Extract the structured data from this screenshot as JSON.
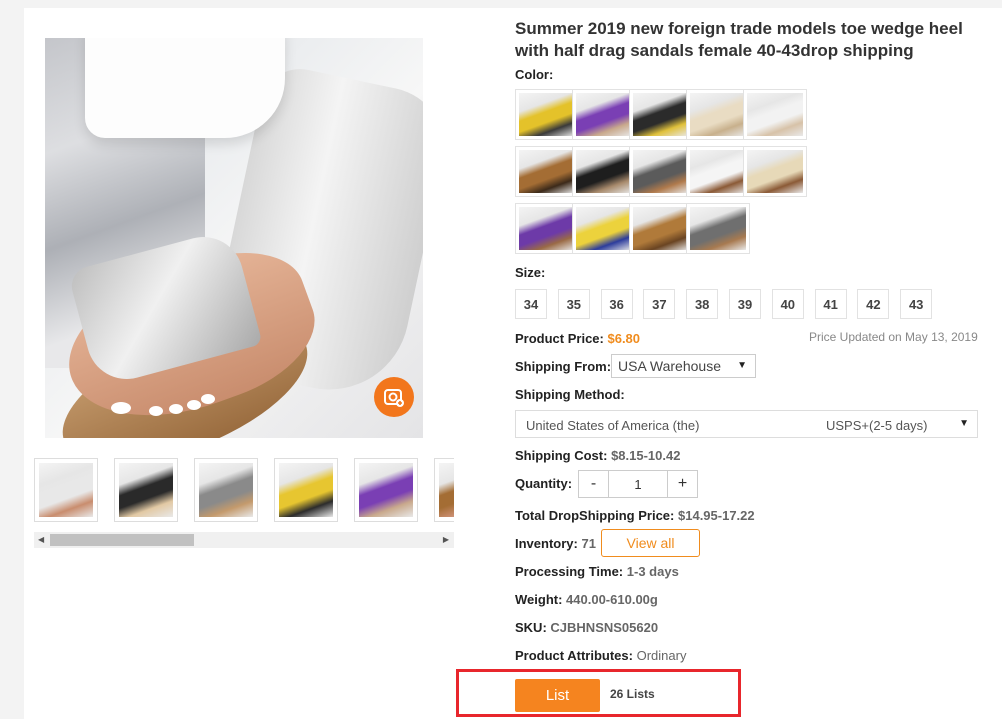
{
  "product": {
    "title": "Summer 2019 new foreign trade models toe wedge heel with half drag sandals female 40-43drop shipping"
  },
  "color": {
    "label": "Color:",
    "swatches": [
      {
        "name": "yellow-black",
        "colors": [
          "#e4c22a",
          "#3a3a3a"
        ]
      },
      {
        "name": "purple",
        "colors": [
          "#7a3fb4",
          "#c9a98c"
        ]
      },
      {
        "name": "black-yellow",
        "colors": [
          "#2b2b2b",
          "#e0c13b"
        ]
      },
      {
        "name": "beige",
        "colors": [
          "#e9dcc3",
          "#c8b08c"
        ]
      },
      {
        "name": "white",
        "colors": [
          "#f2f2f2",
          "#d7c2a8"
        ]
      },
      {
        "name": "leopard",
        "colors": [
          "#a46d34",
          "#3c2a1a"
        ]
      },
      {
        "name": "black",
        "colors": [
          "#1e1e1e",
          "#a7896b"
        ]
      },
      {
        "name": "grey-brown",
        "colors": [
          "#5b5b5b",
          "#b07a4c"
        ]
      },
      {
        "name": "white-brown",
        "colors": [
          "#f5f5f5",
          "#8b5a36"
        ]
      },
      {
        "name": "beige-brown",
        "colors": [
          "#e7d9b8",
          "#8b5a36"
        ]
      },
      {
        "name": "purple-brown",
        "colors": [
          "#6d3aa8",
          "#9a6a45"
        ]
      },
      {
        "name": "yellow-blue",
        "colors": [
          "#ecd23c",
          "#2c3c9c"
        ]
      },
      {
        "name": "leopard-brown",
        "colors": [
          "#b07a3a",
          "#6a4422"
        ]
      },
      {
        "name": "grey-sole",
        "colors": [
          "#6f6f6f",
          "#a87a50"
        ]
      }
    ]
  },
  "size": {
    "label": "Size:",
    "options": [
      "34",
      "35",
      "36",
      "37",
      "38",
      "39",
      "40",
      "41",
      "42",
      "43"
    ]
  },
  "price": {
    "label": "Product Price:",
    "value": "$6.80",
    "updated": "Price Updated on May 13, 2019"
  },
  "shipping_from": {
    "label": "Shipping From:",
    "value": "USA Warehouse"
  },
  "shipping_method": {
    "label": "Shipping Method:",
    "country": "United States of America (the)",
    "carrier": "USPS+(2-5 days)"
  },
  "shipping_cost": {
    "label": "Shipping Cost:",
    "value": "$8.15-10.42"
  },
  "quantity": {
    "label": "Quantity:",
    "minus": "-",
    "value": "1",
    "plus": "+"
  },
  "total": {
    "label": "Total DropShipping Price:",
    "value": "$14.95-17.22"
  },
  "inventory": {
    "label": "Inventory:",
    "value": "71",
    "view_all": "View all"
  },
  "processing": {
    "label": "Processing Time:",
    "value": "1-3 days"
  },
  "weight": {
    "label": "Weight:",
    "value": "440.00-610.00g"
  },
  "sku": {
    "label": "SKU:",
    "value": "CJBHNSNS05620"
  },
  "attributes": {
    "label": "Product Attributes:",
    "value": "Ordinary"
  },
  "list_action": {
    "button": "List",
    "count": "26 Lists"
  },
  "gallery": {
    "thumbs": [
      {
        "name": "white-sandal",
        "colors": [
          "#e8e8e8",
          "#c98d6e"
        ]
      },
      {
        "name": "black-sandal",
        "colors": [
          "#2a2a2a",
          "#e2c9a4"
        ]
      },
      {
        "name": "grey-sandal",
        "colors": [
          "#8a8a8a",
          "#c49a6c"
        ]
      },
      {
        "name": "yellow-sandal",
        "colors": [
          "#e7c630",
          "#2c2c2c"
        ]
      },
      {
        "name": "purple-sandal",
        "colors": [
          "#7a3fb4",
          "#c9a98c"
        ]
      },
      {
        "name": "leopard-sandal",
        "colors": [
          "#a46d34",
          "#c98d6e"
        ]
      }
    ]
  }
}
